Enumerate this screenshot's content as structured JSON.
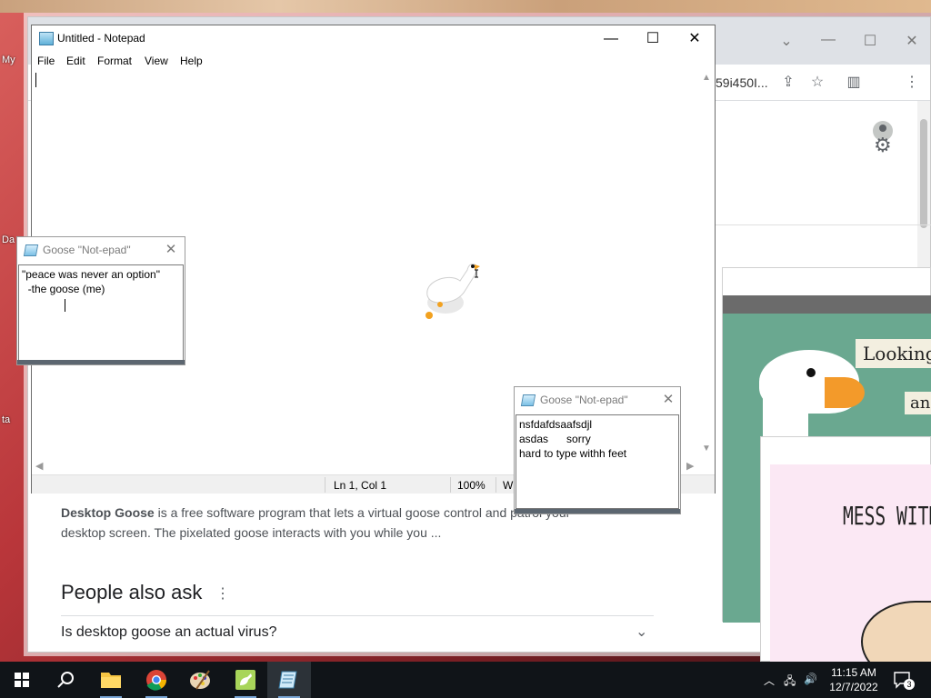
{
  "desktop": {
    "labels": [
      "My",
      "Da",
      "ta"
    ]
  },
  "browser": {
    "url_fragment": "59i450I...",
    "snippet_bold": "Desktop Goose",
    "snippet_rest": " is a free software program that lets a virtual goose control and patrol your desktop screen. The pixelated goose interacts with you while you ...",
    "paa_title": "People also ask",
    "paa_question": "Is desktop goose an actual virus?",
    "image1_caption_a": "Looking",
    "image1_caption_b": "and",
    "image2_caption": "MESS WITH"
  },
  "notepad": {
    "title": "Untitled - Notepad",
    "menu": [
      "File",
      "Edit",
      "Format",
      "View",
      "Help"
    ],
    "content": "",
    "status": {
      "position": "Ln 1, Col 1",
      "zoom": "100%",
      "line_ending_fragment": "W"
    }
  },
  "goose_notes": [
    {
      "title": "Goose \"Not-epad\"",
      "text": "\"peace was never an option\"\n  -the goose (me)"
    },
    {
      "title": "Goose \"Not-epad\"",
      "text": "nsfdafdsaafsdjl\nasdas      sorry\nhard to type withh feet"
    }
  ],
  "taskbar": {
    "apps": [
      "start",
      "search",
      "file-explorer",
      "chrome",
      "paint",
      "goose",
      "notepad"
    ],
    "active_app": "notepad",
    "time": "11:15 AM",
    "date": "12/7/2022",
    "notification_count": "3"
  },
  "colors": {
    "taskbar_bg": "#101418",
    "accent": "#7aa6d6",
    "goose_window_text": "#7a7a7a"
  }
}
